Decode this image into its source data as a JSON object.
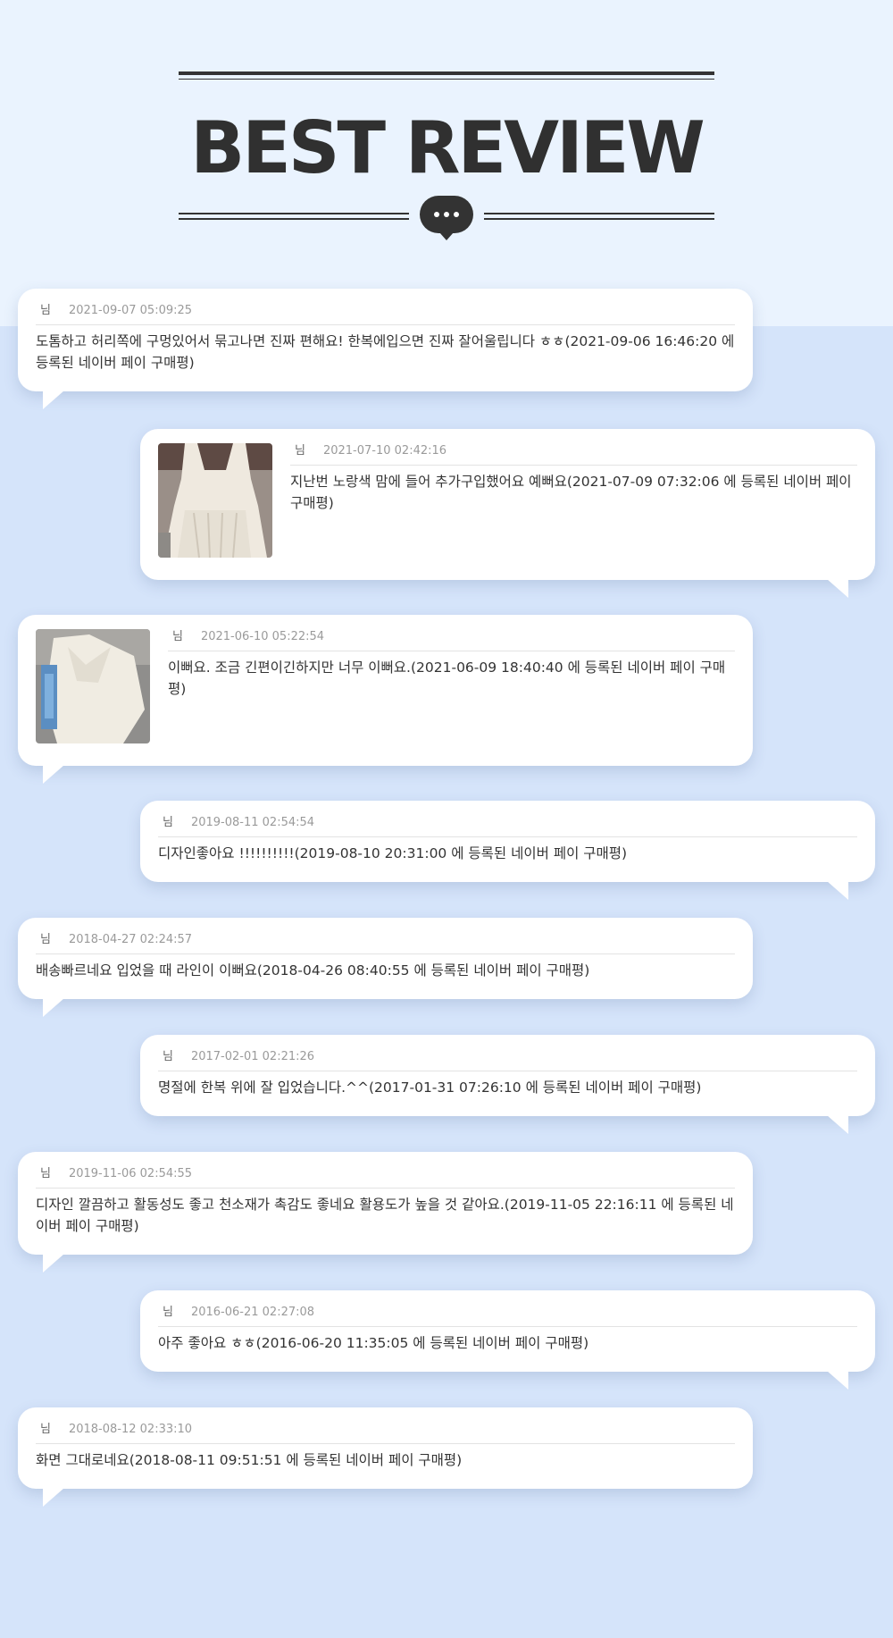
{
  "header": {
    "title": "BEST REVIEW"
  },
  "reviews": [
    {
      "user": "님",
      "date": "2021-09-07 05:09:25",
      "text": "도톰하고 허리쪽에 구멍있어서 묶고나면 진짜 편해요! 한복에입으면 진짜 잘어울립니다 ㅎㅎ(2021-09-06 16:46:20 에 등록된 네이버 페이 구매평)"
    },
    {
      "user": "님",
      "date": "2021-07-10 02:42:16",
      "text": "지난번 노랑색 맘에 들어 추가구입했어요 예뻐요(2021-07-09 07:32:06 에 등록된 네이버 페이 구매평)"
    },
    {
      "user": "님",
      "date": "2021-06-10 05:22:54",
      "text": "이뻐요. 조금 긴편이긴하지만 너무 이뻐요.(2021-06-09 18:40:40 에 등록된 네이버 페이 구매평)"
    },
    {
      "user": "님",
      "date": "2019-08-11 02:54:54",
      "text": "디자인좋아요 !!!!!!!!!!(2019-08-10 20:31:00 에 등록된 네이버 페이 구매평)"
    },
    {
      "user": "님",
      "date": "2018-04-27 02:24:57",
      "text": "배송빠르네요 입었을 때 라인이 이뻐요(2018-04-26 08:40:55 에 등록된 네이버 페이 구매평)"
    },
    {
      "user": "님",
      "date": "2017-02-01 02:21:26",
      "text": "명절에 한복 위에 잘 입었습니다.^^(2017-01-31 07:26:10 에 등록된 네이버 페이 구매평)"
    },
    {
      "user": "님",
      "date": "2019-11-06 02:54:55",
      "text": "디자인 깔끔하고 활동성도 좋고 천소재가 촉감도 좋네요 활용도가 높을 것 같아요.(2019-11-05 22:16:11 에 등록된 네이버 페이 구매평)"
    },
    {
      "user": "님",
      "date": "2016-06-21 02:27:08",
      "text": "아주 좋아요 ㅎㅎ(2016-06-20 11:35:05 에 등록된 네이버 페이 구매평)"
    },
    {
      "user": "님",
      "date": "2018-08-12 02:33:10",
      "text": "화면 그대로네요(2018-08-11 09:51:51 에 등록된 네이버 페이 구매평)"
    }
  ]
}
